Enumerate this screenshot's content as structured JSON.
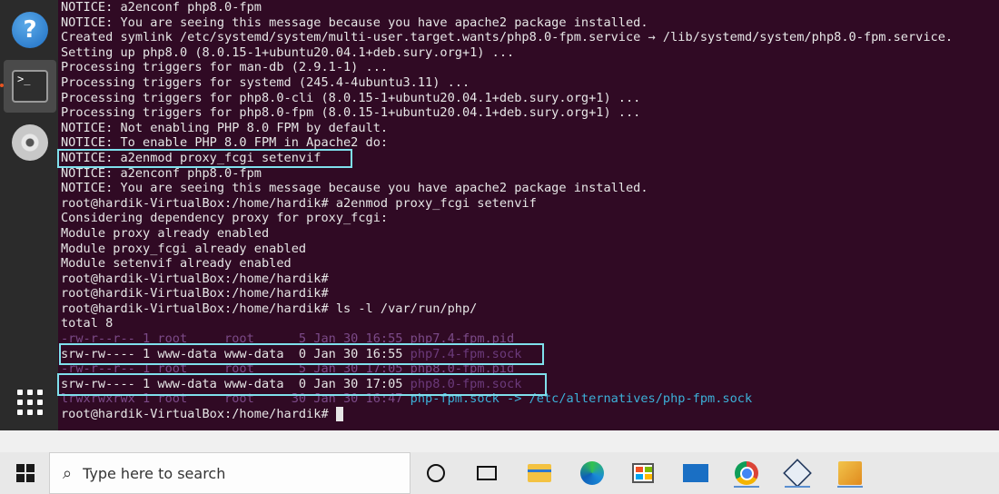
{
  "terminal_lines": [
    "NOTICE: a2enconf php8.0-fpm",
    "NOTICE: You are seeing this message because you have apache2 package installed.",
    "Created symlink /etc/systemd/system/multi-user.target.wants/php8.0-fpm.service → /lib/systemd/system/php8.0-fpm.service.",
    "Setting up php8.0 (8.0.15-1+ubuntu20.04.1+deb.sury.org+1) ...",
    "Processing triggers for man-db (2.9.1-1) ...",
    "Processing triggers for systemd (245.4-4ubuntu3.11) ...",
    "Processing triggers for php8.0-cli (8.0.15-1+ubuntu20.04.1+deb.sury.org+1) ...",
    "Processing triggers for php8.0-fpm (8.0.15-1+ubuntu20.04.1+deb.sury.org+1) ...",
    "NOTICE: Not enabling PHP 8.0 FPM by default.",
    "NOTICE: To enable PHP 8.0 FPM in Apache2 do:",
    "NOTICE: a2enmod proxy_fcgi setenvif",
    "NOTICE: a2enconf php8.0-fpm",
    "NOTICE: You are seeing this message because you have apache2 package installed.",
    "root@hardik-VirtualBox:/home/hardik# a2enmod proxy_fcgi setenvif",
    "Considering dependency proxy for proxy_fcgi:",
    "Module proxy already enabled",
    "Module proxy_fcgi already enabled",
    "Module setenvif already enabled",
    "root@hardik-VirtualBox:/home/hardik#",
    "root@hardik-VirtualBox:/home/hardik#",
    "root@hardik-VirtualBox:/home/hardik# ls -l /var/run/php/",
    "total 8"
  ],
  "ls_rows": [
    {
      "meta": "-rw-r--r-- 1 root     root      5 Jan 30 16:55 ",
      "name": "php7.4-fpm.pid",
      "suffix": "",
      "name_style": "dim",
      "row_style": "dim"
    },
    {
      "meta": "srw-rw---- 1 www-data www-data  0 Jan 30 16:55 ",
      "name": "php7.4-fpm.sock",
      "suffix": "",
      "name_style": "sock",
      "row_style": ""
    },
    {
      "meta": "-rw-r--r-- 1 root     root      5 Jan 30 17:05 ",
      "name": "php8.0-fpm.pid",
      "suffix": "",
      "name_style": "dim",
      "row_style": "dim"
    },
    {
      "meta": "srw-rw---- 1 www-data www-data  0 Jan 30 17:05 ",
      "name": "php8.0-fpm.sock",
      "suffix": "",
      "name_style": "sock",
      "row_style": ""
    },
    {
      "meta": "lrwxrwxrwx 1 root     root     30 Jan 30 16:47 ",
      "name": "php-fpm.sock",
      "suffix": " -> /etc/alternatives/php-fpm.sock",
      "name_style": "link",
      "row_style": "dim"
    }
  ],
  "final_prompt": "root@hardik-VirtualBox:/home/hardik#",
  "dock": {
    "items": [
      {
        "name": "help-icon",
        "glyph": "?"
      },
      {
        "name": "terminal-icon",
        "glyph": ">_"
      },
      {
        "name": "dvd-icon",
        "glyph": ""
      },
      {
        "name": "show-applications-icon",
        "glyph": ""
      }
    ]
  },
  "taskbar": {
    "search_placeholder": "Type here to search",
    "apps": [
      "cortana-icon",
      "task-view-icon",
      "file-explorer-icon",
      "edge-icon",
      "microsoft-store-icon",
      "mail-icon",
      "chrome-icon",
      "virtualbox-icon",
      "vm-manager-icon"
    ]
  },
  "colors": {
    "terminal_bg": "#300a24",
    "highlight_border": "#7fe0ec",
    "dim_text": "#7b4a88",
    "symlink": "#3cb0d8"
  }
}
